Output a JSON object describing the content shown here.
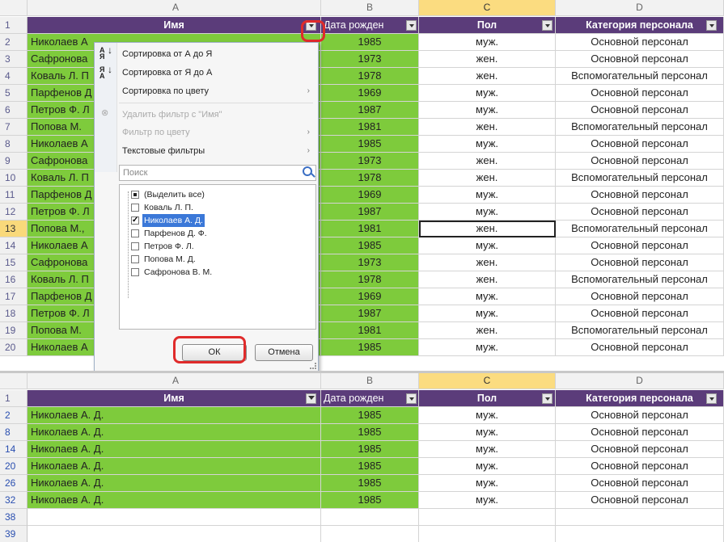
{
  "columns": {
    "A": "A",
    "B": "B",
    "C": "C",
    "D": "D"
  },
  "headers": {
    "name": "Имя",
    "birth": "Дата рожден",
    "gender": "Пол",
    "category": "Категория персонала"
  },
  "top_rows": [
    {
      "n": "2",
      "name": "Николаев А",
      "year": "1985",
      "gender": "муж.",
      "cat": "Основной персонал"
    },
    {
      "n": "3",
      "name": "Сафронова",
      "year": "1973",
      "gender": "жен.",
      "cat": "Основной персонал"
    },
    {
      "n": "4",
      "name": "Коваль Л. П",
      "year": "1978",
      "gender": "жен.",
      "cat": "Вспомогательный персонал"
    },
    {
      "n": "5",
      "name": "Парфенов Д",
      "year": "1969",
      "gender": "муж.",
      "cat": "Основной персонал"
    },
    {
      "n": "6",
      "name": "Петров Ф. Л",
      "year": "1987",
      "gender": "муж.",
      "cat": "Основной персонал"
    },
    {
      "n": "7",
      "name": "Попова М.",
      "year": "1981",
      "gender": "жен.",
      "cat": "Вспомогательный персонал"
    },
    {
      "n": "8",
      "name": "Николаев А",
      "year": "1985",
      "gender": "муж.",
      "cat": "Основной персонал"
    },
    {
      "n": "9",
      "name": "Сафронова",
      "year": "1973",
      "gender": "жен.",
      "cat": "Основной персонал"
    },
    {
      "n": "10",
      "name": "Коваль Л. П",
      "year": "1978",
      "gender": "жен.",
      "cat": "Вспомогательный персонал"
    },
    {
      "n": "11",
      "name": "Парфенов Д",
      "year": "1969",
      "gender": "муж.",
      "cat": "Основной персонал"
    },
    {
      "n": "12",
      "name": "Петров Ф. Л",
      "year": "1987",
      "gender": "муж.",
      "cat": "Основной персонал"
    },
    {
      "n": "13",
      "name": "Попова М.,",
      "year": "1981",
      "gender": "жен.",
      "cat": "Вспомогательный персонал"
    },
    {
      "n": "14",
      "name": "Николаев А",
      "year": "1985",
      "gender": "муж.",
      "cat": "Основной персонал"
    },
    {
      "n": "15",
      "name": "Сафронова",
      "year": "1973",
      "gender": "жен.",
      "cat": "Основной персонал"
    },
    {
      "n": "16",
      "name": "Коваль Л. П",
      "year": "1978",
      "gender": "жен.",
      "cat": "Вспомогательный персонал"
    },
    {
      "n": "17",
      "name": "Парфенов Д",
      "year": "1969",
      "gender": "муж.",
      "cat": "Основной персонал"
    },
    {
      "n": "18",
      "name": "Петров Ф. Л",
      "year": "1987",
      "gender": "муж.",
      "cat": "Основной персонал"
    },
    {
      "n": "19",
      "name": "Попова М.",
      "year": "1981",
      "gender": "жен.",
      "cat": "Вспомогательный персонал"
    },
    {
      "n": "20",
      "name": "Николаев А",
      "year": "1985",
      "gender": "муж.",
      "cat": "Основной персонал"
    }
  ],
  "bottom_rows": [
    {
      "n": "2",
      "name": "Николаев А. Д.",
      "year": "1985",
      "gender": "муж.",
      "cat": "Основной персонал"
    },
    {
      "n": "8",
      "name": "Николаев А. Д.",
      "year": "1985",
      "gender": "муж.",
      "cat": "Основной персонал"
    },
    {
      "n": "14",
      "name": "Николаев А. Д.",
      "year": "1985",
      "gender": "муж.",
      "cat": "Основной персонал"
    },
    {
      "n": "20",
      "name": "Николаев А. Д.",
      "year": "1985",
      "gender": "муж.",
      "cat": "Основной персонал"
    },
    {
      "n": "26",
      "name": "Николаев А. Д.",
      "year": "1985",
      "gender": "муж.",
      "cat": "Основной персонал"
    },
    {
      "n": "32",
      "name": "Николаев А. Д.",
      "year": "1985",
      "gender": "муж.",
      "cat": "Основной персонал"
    },
    {
      "n": "38",
      "name": "",
      "year": "",
      "gender": "",
      "cat": ""
    },
    {
      "n": "39",
      "name": "",
      "year": "",
      "gender": "",
      "cat": ""
    }
  ],
  "menu": {
    "sort_az": "Сортировка от А до Я",
    "sort_za": "Сортировка от Я до А",
    "sort_color": "Сортировка по цвету",
    "remove_filter": "Удалить фильтр с \"Имя\"",
    "filter_color": "Фильтр по цвету",
    "text_filters": "Текстовые фильтры",
    "search_placeholder": "Поиск",
    "items": [
      {
        "label": "(Выделить все)",
        "state": "partial"
      },
      {
        "label": "Коваль Л. П.",
        "state": "off"
      },
      {
        "label": "Николаев А. Д.",
        "state": "on"
      },
      {
        "label": "Парфенов Д. Ф.",
        "state": "off"
      },
      {
        "label": "Петров Ф. Л.",
        "state": "off"
      },
      {
        "label": "Попова М. Д.",
        "state": "off"
      },
      {
        "label": "Сафронова В. М.",
        "state": "off"
      }
    ],
    "ok": "ОК",
    "cancel": "Отмена"
  },
  "colors": {
    "header_bg": "#5b3c7a",
    "name_fill": "#7ecb3c",
    "birth_fill": "#7ecb3c",
    "highlight": "#e02b2b"
  }
}
